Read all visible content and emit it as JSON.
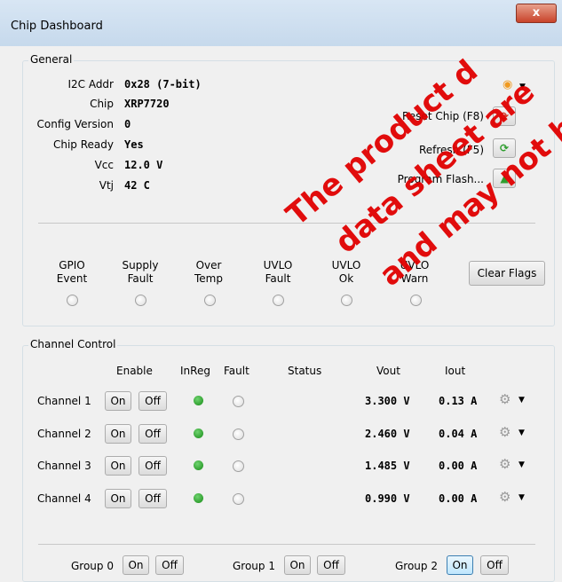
{
  "window": {
    "title": "Chip Dashboard",
    "close": "x"
  },
  "general": {
    "legend": "General",
    "fields": [
      {
        "label": "I2C Addr",
        "value": "0x28 (7-bit)"
      },
      {
        "label": "Chip",
        "value": "XRP7720"
      },
      {
        "label": "Config Version",
        "value": "0"
      },
      {
        "label": "Chip Ready",
        "value": "Yes"
      },
      {
        "label": "Vcc",
        "value": "12.0 V"
      },
      {
        "label": "Vtj",
        "value": "42 C"
      }
    ],
    "actions": [
      {
        "label": "Reset Chip (F8)",
        "icon": "reset-icon"
      },
      {
        "label": "Refresh (F5)",
        "icon": "refresh-icon"
      },
      {
        "label": "Program Flash...",
        "icon": "upload-arrow-icon"
      }
    ],
    "flags": [
      {
        "line1": "GPIO",
        "line2": "Event"
      },
      {
        "line1": "Supply",
        "line2": "Fault"
      },
      {
        "line1": "Over",
        "line2": "Temp"
      },
      {
        "line1": "UVLO",
        "line2": "Fault"
      },
      {
        "line1": "UVLO",
        "line2": "Ok"
      },
      {
        "line1": "UVLO",
        "line2": "Warn"
      }
    ],
    "clear_flags": "Clear Flags"
  },
  "channel_control": {
    "legend": "Channel Control",
    "headers": {
      "enable": "Enable",
      "inreg": "InReg",
      "fault": "Fault",
      "status": "Status",
      "vout": "Vout",
      "iout": "Iout"
    },
    "on_label": "On",
    "off_label": "Off",
    "channels": [
      {
        "name": "Channel 1",
        "vout": "3.300 V",
        "iout": "0.13 A"
      },
      {
        "name": "Channel 2",
        "vout": "2.460 V",
        "iout": "0.04 A"
      },
      {
        "name": "Channel 3",
        "vout": "1.485 V",
        "iout": "0.00 A"
      },
      {
        "name": "Channel 4",
        "vout": "0.990 V",
        "iout": "0.00 A"
      }
    ],
    "groups": [
      {
        "name": "Group 0"
      },
      {
        "name": "Group 1"
      },
      {
        "name": "Group 2"
      }
    ]
  },
  "watermark": [
    "The product d",
    "data sheet are",
    "and may not be"
  ],
  "colors": {
    "watermark": "#e10000",
    "led_on": "#1a9a1a",
    "window_frame": "#c6d9ec"
  }
}
